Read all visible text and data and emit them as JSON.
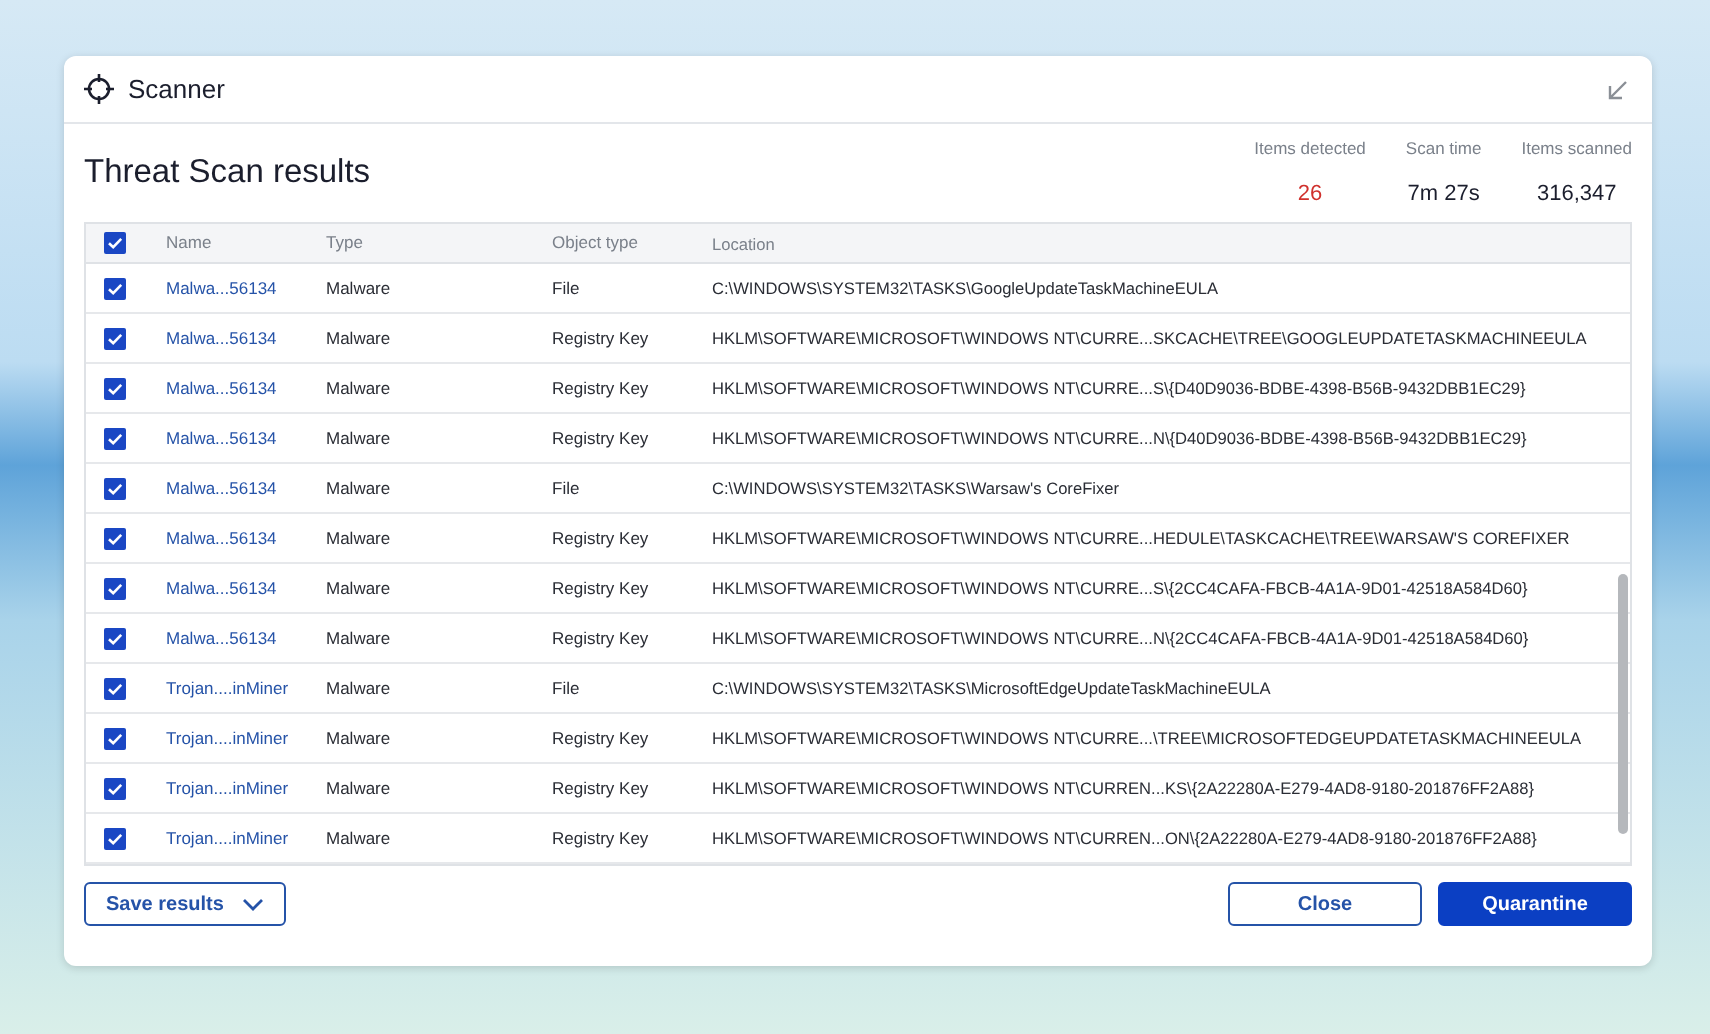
{
  "window": {
    "title": "Scanner"
  },
  "heading": "Threat Scan results",
  "stats": [
    {
      "label": "Items detected",
      "value": "26",
      "kind": "alert"
    },
    {
      "label": "Scan time",
      "value": "7m 27s",
      "kind": "normal"
    },
    {
      "label": "Items scanned",
      "value": "316,347",
      "kind": "normal"
    }
  ],
  "table": {
    "select_all_checked": true,
    "columns": [
      "Name",
      "Type",
      "Object type",
      "Location"
    ],
    "rows": [
      {
        "checked": true,
        "name": "Malwa...56134",
        "type": "Malware",
        "object_type": "File",
        "location": "C:\\WINDOWS\\SYSTEM32\\TASKS\\GoogleUpdateTaskMachineEULA"
      },
      {
        "checked": true,
        "name": "Malwa...56134",
        "type": "Malware",
        "object_type": "Registry Key",
        "location": "HKLM\\SOFTWARE\\MICROSOFT\\WINDOWS NT\\CURRE...SKCACHE\\TREE\\GOOGLEUPDATETASKMACHINEEULA"
      },
      {
        "checked": true,
        "name": "Malwa...56134",
        "type": "Malware",
        "object_type": "Registry Key",
        "location": "HKLM\\SOFTWARE\\MICROSOFT\\WINDOWS NT\\CURRE...S\\{D40D9036-BDBE-4398-B56B-9432DBB1EC29}"
      },
      {
        "checked": true,
        "name": "Malwa...56134",
        "type": "Malware",
        "object_type": "Registry Key",
        "location": "HKLM\\SOFTWARE\\MICROSOFT\\WINDOWS NT\\CURRE...N\\{D40D9036-BDBE-4398-B56B-9432DBB1EC29}"
      },
      {
        "checked": true,
        "name": "Malwa...56134",
        "type": "Malware",
        "object_type": "File",
        "location": "C:\\WINDOWS\\SYSTEM32\\TASKS\\Warsaw's CoreFixer"
      },
      {
        "checked": true,
        "name": "Malwa...56134",
        "type": "Malware",
        "object_type": "Registry Key",
        "location": "HKLM\\SOFTWARE\\MICROSOFT\\WINDOWS NT\\CURRE...HEDULE\\TASKCACHE\\TREE\\WARSAW'S COREFIXER"
      },
      {
        "checked": true,
        "name": "Malwa...56134",
        "type": "Malware",
        "object_type": "Registry Key",
        "location": "HKLM\\SOFTWARE\\MICROSOFT\\WINDOWS NT\\CURRE...S\\{2CC4CAFA-FBCB-4A1A-9D01-42518A584D60}"
      },
      {
        "checked": true,
        "name": "Malwa...56134",
        "type": "Malware",
        "object_type": "Registry Key",
        "location": "HKLM\\SOFTWARE\\MICROSOFT\\WINDOWS NT\\CURRE...N\\{2CC4CAFA-FBCB-4A1A-9D01-42518A584D60}"
      },
      {
        "checked": true,
        "name": "Trojan....inMiner",
        "type": "Malware",
        "object_type": "File",
        "location": "C:\\WINDOWS\\SYSTEM32\\TASKS\\MicrosoftEdgeUpdateTaskMachineEULA"
      },
      {
        "checked": true,
        "name": "Trojan....inMiner",
        "type": "Malware",
        "object_type": "Registry Key",
        "location": "HKLM\\SOFTWARE\\MICROSOFT\\WINDOWS NT\\CURRE...\\TREE\\MICROSOFTEDGEUPDATETASKMACHINEEULA"
      },
      {
        "checked": true,
        "name": "Trojan....inMiner",
        "type": "Malware",
        "object_type": "Registry Key",
        "location": "HKLM\\SOFTWARE\\MICROSOFT\\WINDOWS NT\\CURREN...KS\\{2A22280A-E279-4AD8-9180-201876FF2A88}"
      },
      {
        "checked": true,
        "name": "Trojan....inMiner",
        "type": "Malware",
        "object_type": "Registry Key",
        "location": "HKLM\\SOFTWARE\\MICROSOFT\\WINDOWS NT\\CURREN...ON\\{2A22280A-E279-4AD8-9180-201876FF2A88}"
      }
    ]
  },
  "footer": {
    "save_button": "Save results",
    "close_button": "Close",
    "quarantine_button": "Quarantine"
  }
}
